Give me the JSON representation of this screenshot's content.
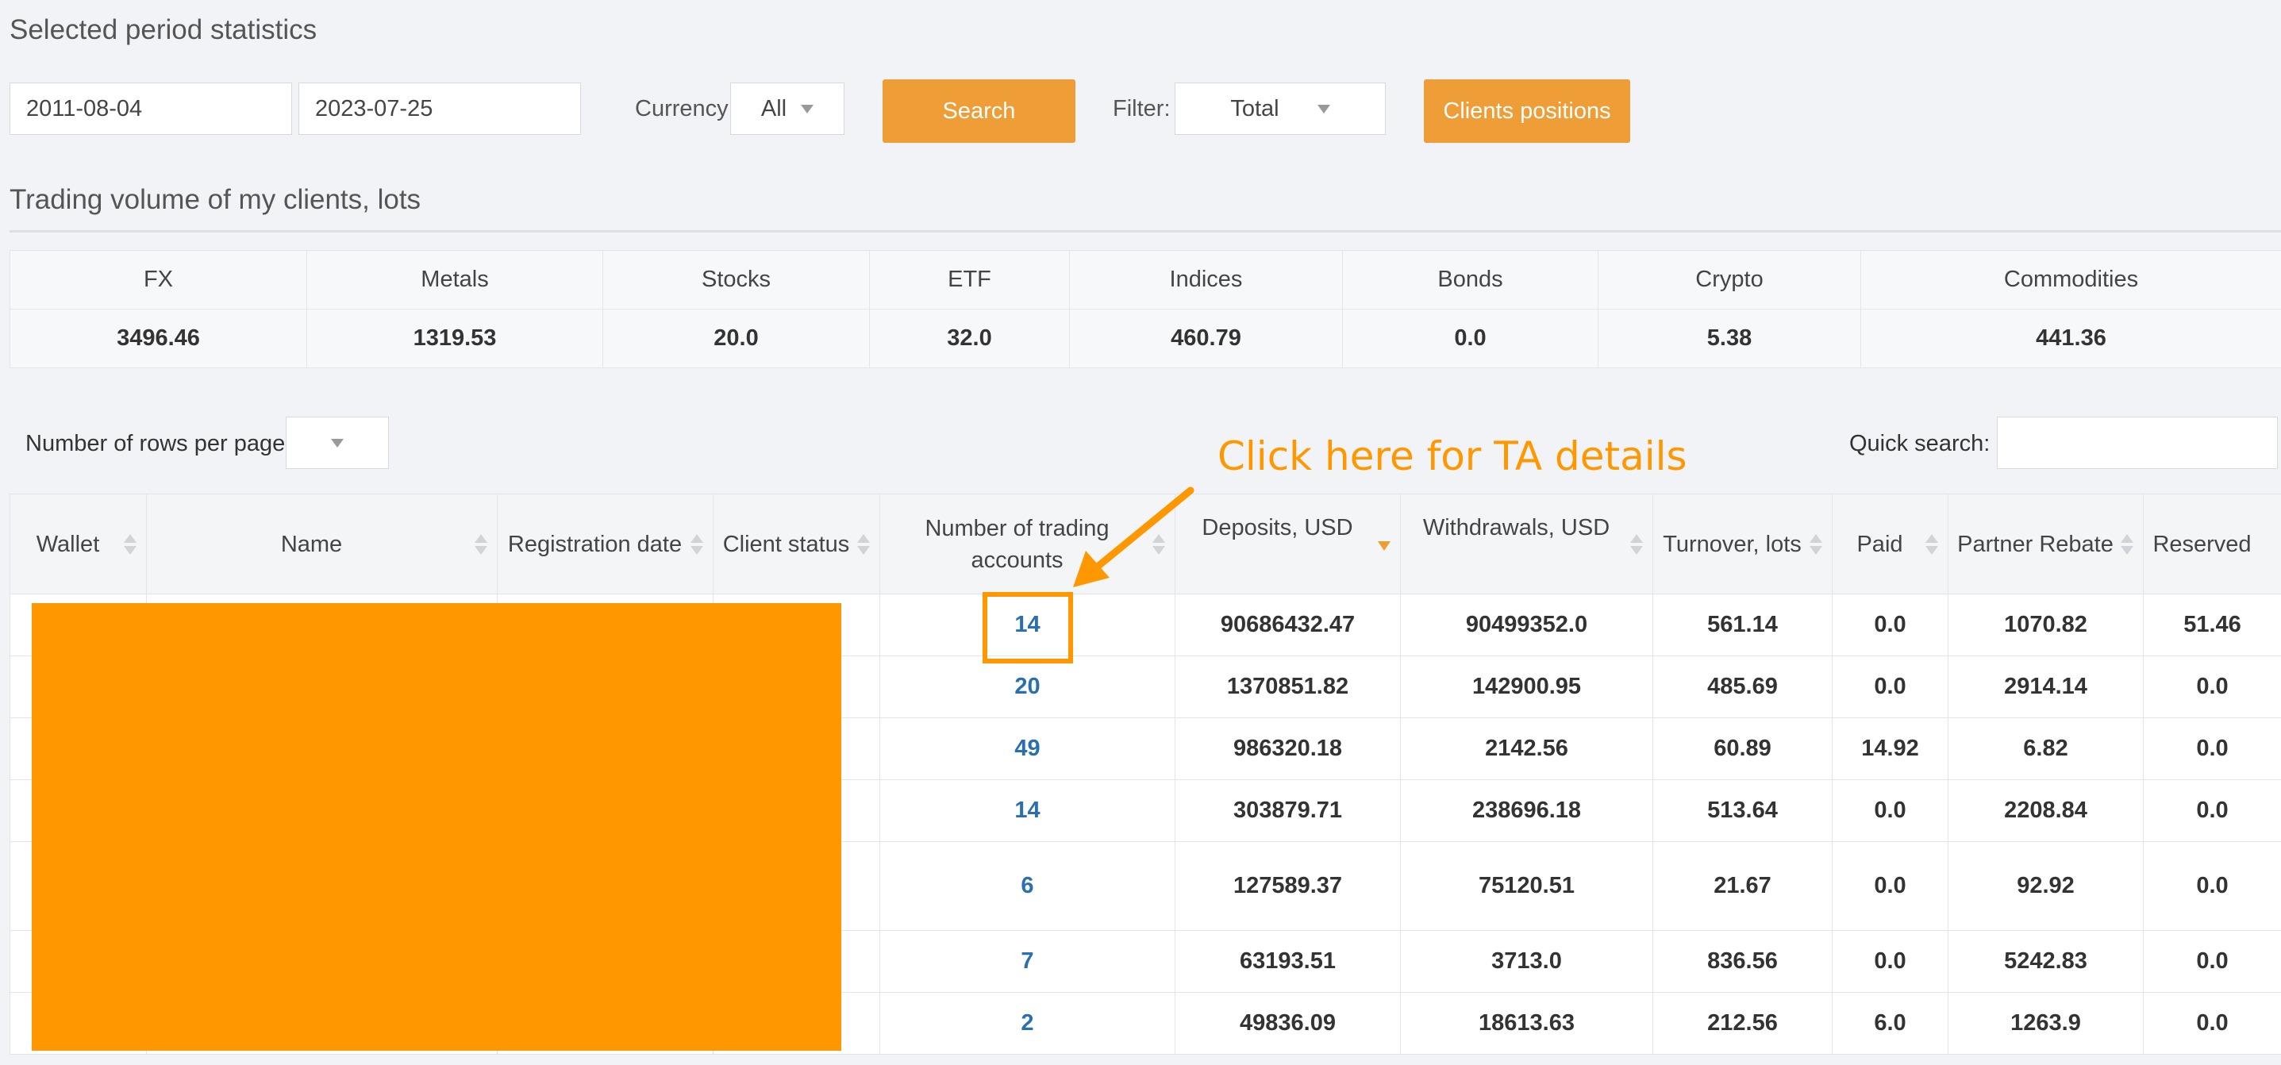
{
  "page_title": "Selected period statistics",
  "filters": {
    "date_from": "2011-08-04",
    "date_to": "2023-07-25",
    "currency_label": "Currency",
    "currency_value": "All",
    "search_label": "Search",
    "filter_label": "Filter:",
    "filter_value": "Total",
    "clients_positions_label": "Clients positions"
  },
  "volume": {
    "title": "Trading volume of my clients, lots",
    "headers": [
      "FX",
      "Metals",
      "Stocks",
      "ETF",
      "Indices",
      "Bonds",
      "Crypto",
      "Commodities"
    ],
    "values": [
      "3496.46",
      "1319.53",
      "20.0",
      "32.0",
      "460.79",
      "0.0",
      "5.38",
      "441.36"
    ]
  },
  "table_controls": {
    "rows_per_page_label": "Number of rows per page",
    "quick_search_label": "Quick search:"
  },
  "annotation": "Click here for TA details",
  "table": {
    "headers": [
      "Wallet",
      "Name",
      "Registration date",
      "Client status",
      "Number of trading accounts",
      "Deposits, USD",
      "Withdrawals, USD",
      "Turnover, lots",
      "Paid",
      "Partner Rebate",
      "Reserved"
    ],
    "rows": [
      {
        "accounts": "14",
        "deposits": "90686432.47",
        "withdrawals": "90499352.0",
        "turnover": "561.14",
        "paid": "0.0",
        "rebate": "1070.82",
        "reserved": "51.46"
      },
      {
        "accounts": "20",
        "deposits": "1370851.82",
        "withdrawals": "142900.95",
        "turnover": "485.69",
        "paid": "0.0",
        "rebate": "2914.14",
        "reserved": "0.0"
      },
      {
        "accounts": "49",
        "deposits": "986320.18",
        "withdrawals": "2142.56",
        "turnover": "60.89",
        "paid": "14.92",
        "rebate": "6.82",
        "reserved": "0.0"
      },
      {
        "accounts": "14",
        "deposits": "303879.71",
        "withdrawals": "238696.18",
        "turnover": "513.64",
        "paid": "0.0",
        "rebate": "2208.84",
        "reserved": "0.0"
      },
      {
        "accounts": "6",
        "deposits": "127589.37",
        "withdrawals": "75120.51",
        "turnover": "21.67",
        "paid": "0.0",
        "rebate": "92.92",
        "reserved": "0.0"
      },
      {
        "accounts": "7",
        "deposits": "63193.51",
        "withdrawals": "3713.0",
        "turnover": "836.56",
        "paid": "0.0",
        "rebate": "5242.83",
        "reserved": "0.0"
      },
      {
        "accounts": "2",
        "deposits": "49836.09",
        "withdrawals": "18613.63",
        "turnover": "212.56",
        "paid": "6.0",
        "rebate": "1263.9",
        "reserved": "0.0"
      }
    ]
  },
  "colors": {
    "accent": "#ee9d37",
    "annotation": "#ff9800",
    "link": "#2a6fb0"
  }
}
